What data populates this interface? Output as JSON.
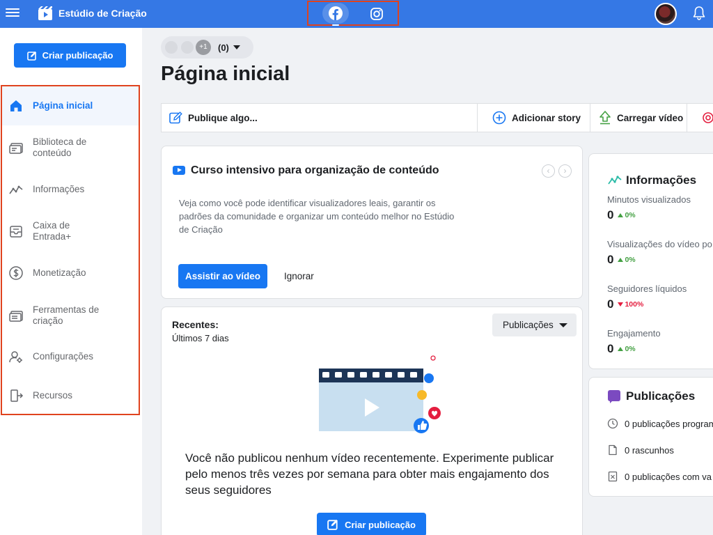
{
  "app": {
    "title": "Estúdio de Criação",
    "platforms": [
      "facebook-icon",
      "instagram-icon"
    ],
    "accent_color": "#1877f2",
    "topbar_color": "#3578e5",
    "highlight_color": "#e0431e"
  },
  "sidebar": {
    "create_label": "Criar publicação",
    "items": [
      {
        "label": "Página inicial",
        "icon": "home-icon",
        "active": true
      },
      {
        "label": "Biblioteca de conteúdo",
        "icon": "content-library-icon",
        "active": false
      },
      {
        "label": "Informações",
        "icon": "insights-icon",
        "active": false
      },
      {
        "label": "Caixa de Entrada+",
        "icon": "inbox-icon",
        "active": false
      },
      {
        "label": "Monetização",
        "icon": "dollar-icon",
        "active": false
      },
      {
        "label": "Ferramentas de criação",
        "icon": "creative-tools-icon",
        "active": false
      },
      {
        "label": "Configurações",
        "icon": "settings-icon",
        "active": false
      },
      {
        "label": "Recursos",
        "icon": "resources-icon",
        "active": false
      }
    ]
  },
  "page_selector": {
    "more_count": "+1",
    "notification_count": "(0)"
  },
  "main": {
    "heading": "Página inicial",
    "publish_bar": {
      "post": "Publique algo...",
      "story": "Adicionar story",
      "upload": "Carregar vídeo"
    },
    "course": {
      "title": "Curso intensivo para organização de conteúdo",
      "description": "Veja como você pode identificar visualizadores leais, garantir os padrões da comunidade e organizar um conteúdo melhor no Estúdio de Criação",
      "watch_label": "Assistir ao vídeo",
      "ignore_label": "Ignorar"
    },
    "recent": {
      "title": "Recentes:",
      "subtitle": "Últimos 7 dias",
      "filter": "Publicações",
      "empty_message": "Você não publicou nenhum vídeo recentemente. Experimente publicar pelo menos três vezes por semana para obter mais engajamento dos seus seguidores",
      "create_label": "Criar publicação"
    }
  },
  "insights": {
    "title": "Informações",
    "metrics": [
      {
        "label": "Minutos visualizados",
        "value": "0",
        "delta": "0%",
        "direction": "up"
      },
      {
        "label": "Visualizações do vídeo po",
        "value": "0",
        "delta": "0%",
        "direction": "up"
      },
      {
        "label": "Seguidores líquidos",
        "value": "0",
        "delta": "100%",
        "direction": "down"
      },
      {
        "label": "Engajamento",
        "value": "0",
        "delta": "0%",
        "direction": "up"
      }
    ],
    "up_color": "#44a043",
    "down_color": "#e41e3f"
  },
  "posts": {
    "title": "Publicações",
    "rows": [
      {
        "label": "0 publicações program",
        "icon": "clock-icon"
      },
      {
        "label": "0 rascunhos",
        "icon": "draft-icon"
      },
      {
        "label": "0 publicações com va",
        "icon": "expired-post-icon"
      }
    ]
  }
}
